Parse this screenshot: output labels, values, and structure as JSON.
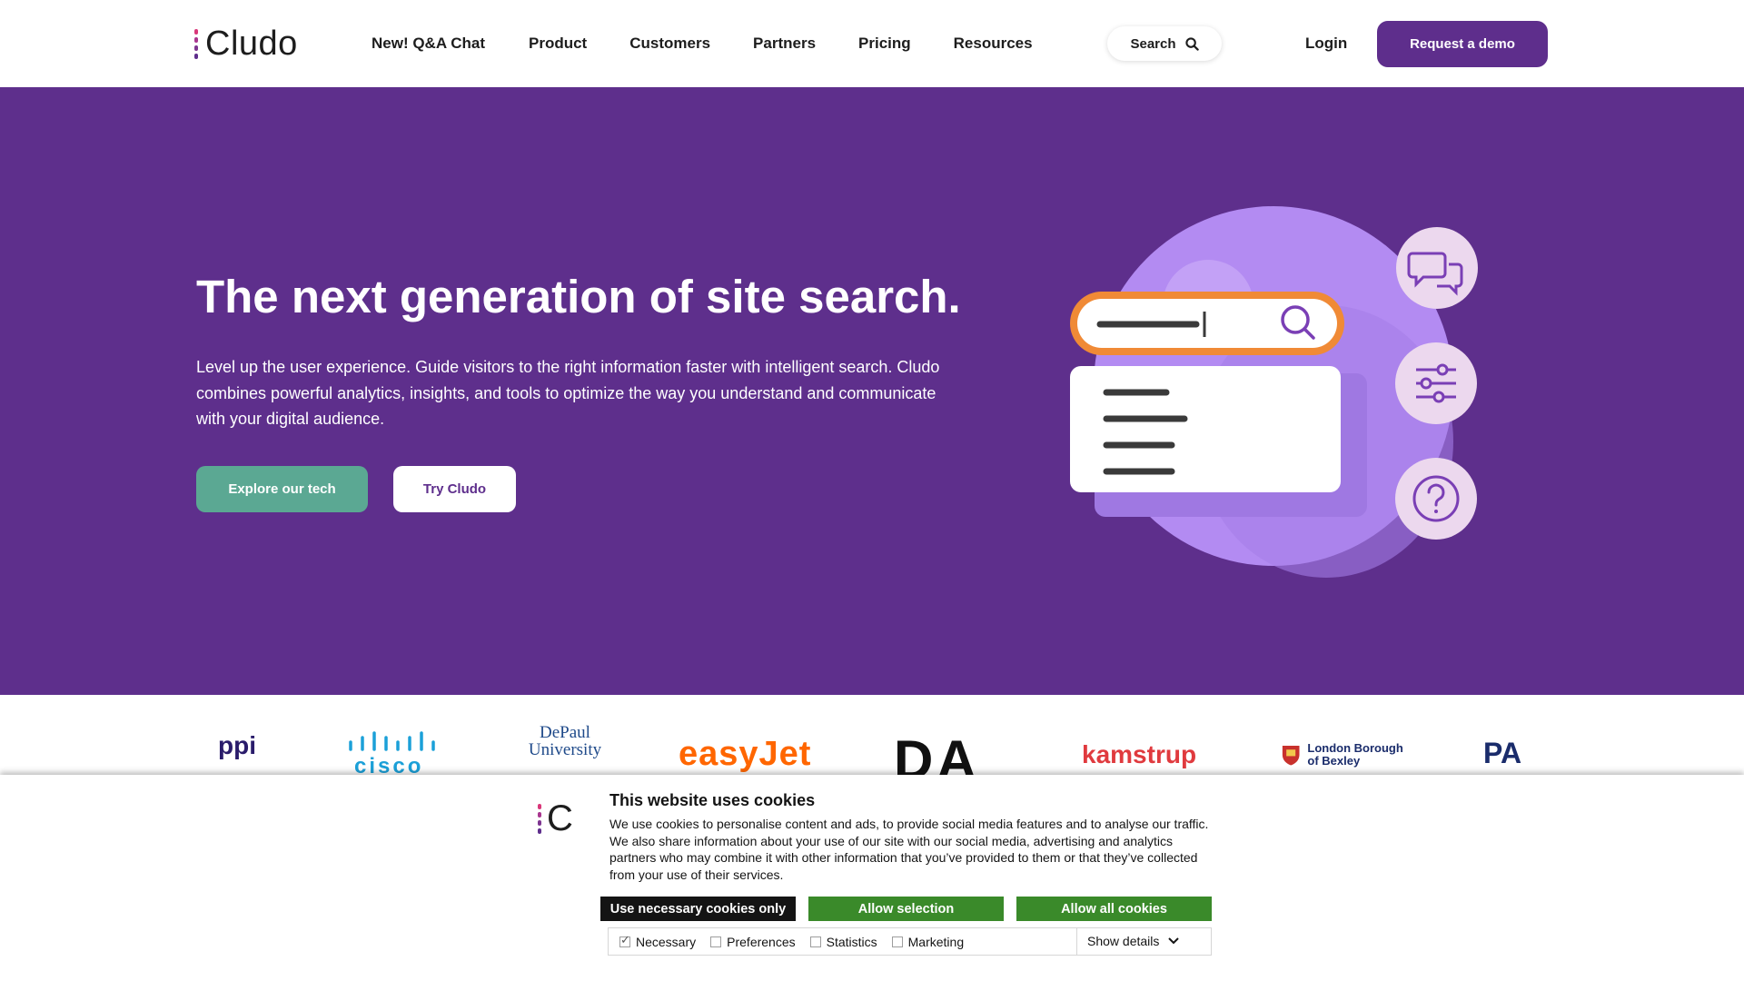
{
  "header": {
    "logo_text": "Cludo",
    "nav": [
      {
        "label": "New! Q&A Chat"
      },
      {
        "label": "Product"
      },
      {
        "label": "Customers"
      },
      {
        "label": "Partners"
      },
      {
        "label": "Pricing"
      },
      {
        "label": "Resources"
      }
    ],
    "search_label": "Search",
    "login_label": "Login",
    "demo_label": "Request a demo"
  },
  "hero": {
    "title": "The next generation of site search.",
    "text": "Level up the user experience. Guide visitors to the right information faster with intelligent search. Cludo combines powerful analytics, insights, and tools to optimize the way you understand and communicate with your digital audience.",
    "explore_label": "Explore our tech",
    "try_label": "Try Cludo"
  },
  "logos": {
    "items": [
      "ppi",
      "cisco",
      "DePaul University",
      "easyJet",
      "DA",
      "kamstrup",
      "London Borough of Bexley",
      "PA"
    ]
  },
  "cookie": {
    "logo_text": "C",
    "title": "This website uses cookies",
    "text": "We use cookies to personalise content and ads, to provide social media features and to analyse our traffic. We also share information about your use of our site with our social media, advertising and analytics partners who may combine it with other information that you’ve provided to them or that they’ve collected from your use of their services.",
    "btn_necessary": "Use necessary cookies only",
    "btn_selection": "Allow selection",
    "btn_all": "Allow all cookies",
    "options": [
      {
        "label": "Necessary",
        "checked": true
      },
      {
        "label": "Preferences",
        "checked": false
      },
      {
        "label": "Statistics",
        "checked": false
      },
      {
        "label": "Marketing",
        "checked": false
      }
    ],
    "show_details": "Show details"
  },
  "colors": {
    "brand_purple": "#5e2f8c",
    "teal": "#5ba893",
    "cookie_green": "#3a8a2a",
    "orange": "#f08a36"
  }
}
